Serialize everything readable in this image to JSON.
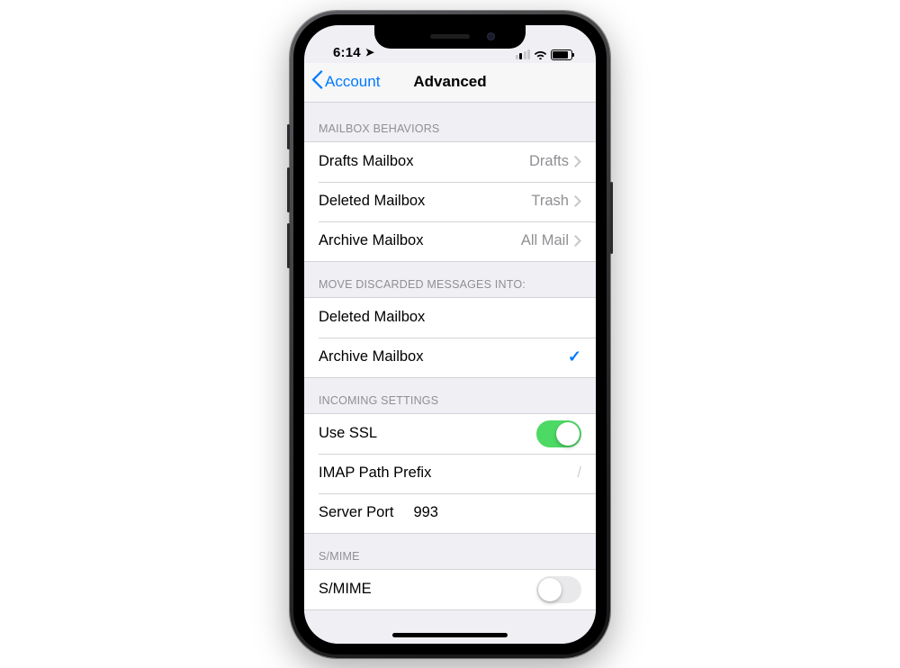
{
  "status": {
    "time": "6:14",
    "location_glyph": "➤"
  },
  "nav": {
    "back_label": "Account",
    "title": "Advanced"
  },
  "sections": {
    "mailbox_behaviors": {
      "header": "MAILBOX BEHAVIORS",
      "rows": [
        {
          "label": "Drafts Mailbox",
          "value": "Drafts"
        },
        {
          "label": "Deleted Mailbox",
          "value": "Trash"
        },
        {
          "label": "Archive Mailbox",
          "value": "All Mail"
        }
      ]
    },
    "move_discarded": {
      "header": "MOVE DISCARDED MESSAGES INTO:",
      "rows": [
        {
          "label": "Deleted Mailbox",
          "selected": false
        },
        {
          "label": "Archive Mailbox",
          "selected": true
        }
      ]
    },
    "incoming": {
      "header": "INCOMING SETTINGS",
      "use_ssl": {
        "label": "Use SSL",
        "on": true
      },
      "imap_prefix": {
        "label": "IMAP Path Prefix",
        "value": "/"
      },
      "server_port": {
        "label": "Server Port",
        "value": "993"
      }
    },
    "smime": {
      "header": "S/MIME",
      "row": {
        "label": "S/MIME",
        "on": false
      }
    }
  },
  "colors": {
    "accent": "#007aff",
    "toggle_on": "#4cd964"
  }
}
